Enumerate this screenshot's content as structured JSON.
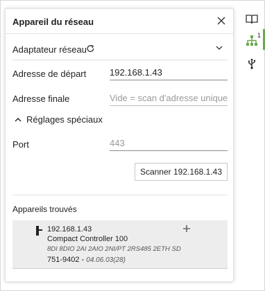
{
  "panel": {
    "title": "Appareil du réseau",
    "adapter_label": "Adaptateur réseau",
    "start_label": "Adresse de départ",
    "start_value": "192.168.1.43",
    "end_label": "Adresse finale",
    "end_placeholder": "Vide = scan d'adresse unique",
    "special_label": "Réglages spéciaux",
    "port_label": "Port",
    "port_placeholder": "443",
    "scan_button": "Scanner 192.168.1.43",
    "found_label": "Appareils trouvés"
  },
  "device": {
    "ip": "192.168.1.43",
    "name": "Compact Controller 100",
    "description": "8DI 8DIO 2AI 2AIO 2NI/PT 2RS485 2ETH SD",
    "order_number": "751-9402",
    "separator": " - ",
    "firmware": "04.06.03(28)"
  },
  "rail": {
    "network_badge": "1"
  },
  "icons": {
    "close": "close-icon",
    "refresh": "refresh-icon",
    "chevron_down": "chevron-down-icon",
    "chevron_up": "chevron-up-icon",
    "add": "plus-icon",
    "device": "device-icon",
    "book": "book-icon",
    "network": "network-icon",
    "usb": "usb-icon"
  },
  "colors": {
    "accent_green": "#6aa84f",
    "panel_border": "#e2e2e2",
    "device_bg": "#ededed"
  }
}
